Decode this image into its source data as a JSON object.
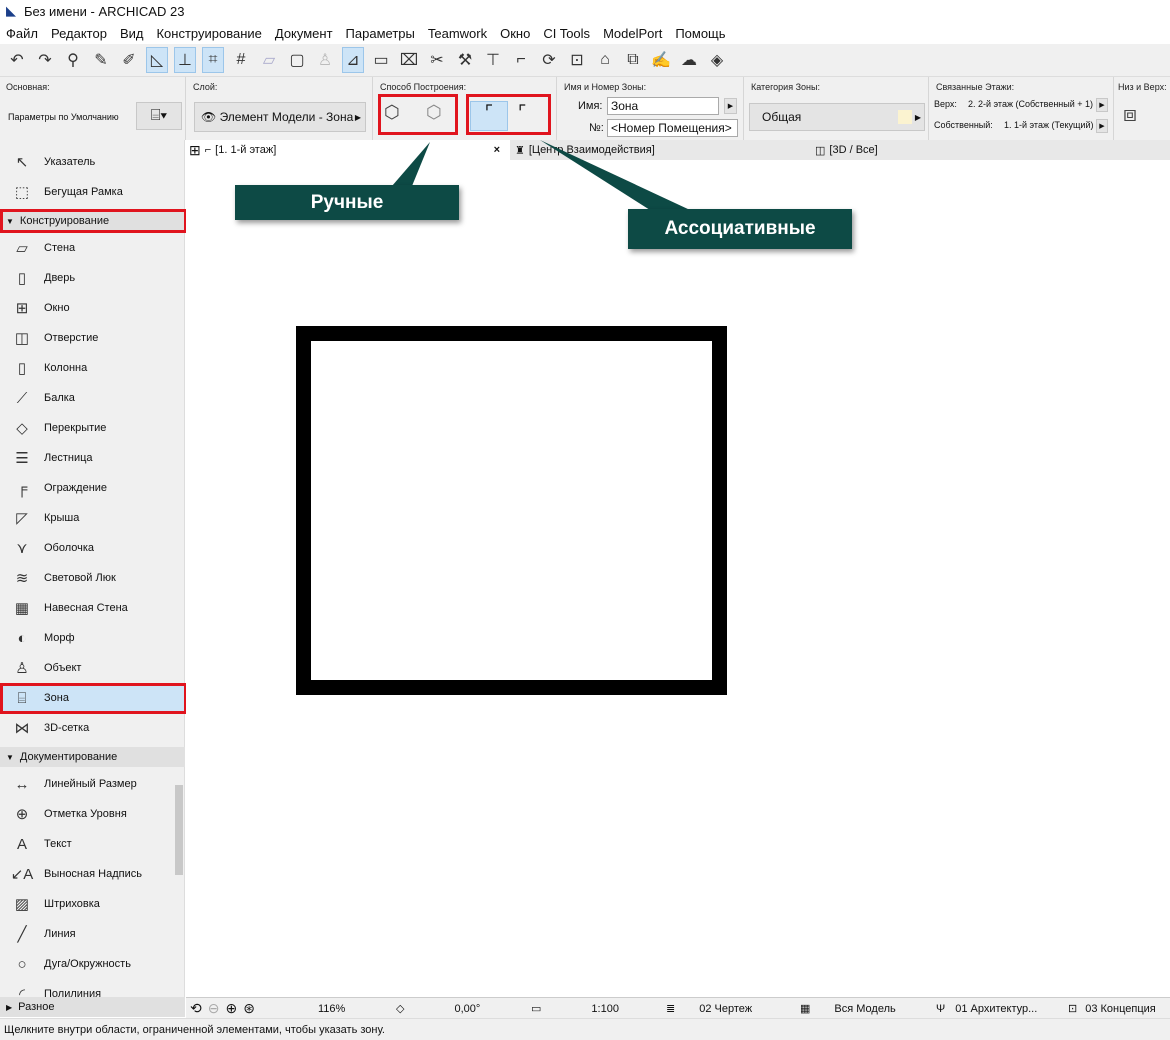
{
  "window": {
    "title": "Без имени - ARCHICAD 23"
  },
  "menu": [
    "Файл",
    "Редактор",
    "Вид",
    "Конструирование",
    "Документ",
    "Параметры",
    "Teamwork",
    "Окно",
    "CI Tools",
    "ModelPort",
    "Помощь"
  ],
  "infobox": {
    "main_label": "Основная:",
    "default_params": "Параметры по Умолчанию",
    "layer_label": "Слой:",
    "layer_value": "Элемент Модели - Зона",
    "method_label": "Способ Построения:",
    "zone_name_label": "Имя и Номер Зоны:",
    "name_label": "Имя:",
    "name_value": "Зона",
    "number_label": "№:",
    "number_value": "<Номер Помещения>",
    "category_label": "Категория Зоны:",
    "category_value": "Общая",
    "category_color": "#fbf3d0",
    "stories_label": "Связанные Этажи:",
    "top_label": "Верх:",
    "top_value": "2. 2-й этаж (Собственный + 1)",
    "own_label": "Собственный:",
    "own_value": "1. 1-й этаж (Текущий)",
    "bottom_top_label": "Низ и Верх:"
  },
  "tabs": [
    {
      "label": "[1. 1-й этаж]",
      "close": "×"
    },
    {
      "label": "[Центр Взаимодействия]"
    },
    {
      "label": "[3D / Все]"
    }
  ],
  "toolbox": {
    "items_top": [
      {
        "label": "Указатель",
        "icon": "↖"
      },
      {
        "label": "Бегущая Рамка",
        "icon": "⬚"
      }
    ],
    "section1": "Конструирование",
    "items1": [
      {
        "label": "Стена",
        "icon": "▱"
      },
      {
        "label": "Дверь",
        "icon": "▯"
      },
      {
        "label": "Окно",
        "icon": "⊞"
      },
      {
        "label": "Отверстие",
        "icon": "◫"
      },
      {
        "label": "Колонна",
        "icon": "▯"
      },
      {
        "label": "Балка",
        "icon": "⟋"
      },
      {
        "label": "Перекрытие",
        "icon": "◇"
      },
      {
        "label": "Лестница",
        "icon": "☰"
      },
      {
        "label": "Ограждение",
        "icon": "╒"
      },
      {
        "label": "Крыша",
        "icon": "◸"
      },
      {
        "label": "Оболочка",
        "icon": "⋎"
      },
      {
        "label": "Световой Люк",
        "icon": "≋"
      },
      {
        "label": "Навесная Стена",
        "icon": "▦"
      },
      {
        "label": "Морф",
        "icon": "◐"
      },
      {
        "label": "Объект",
        "icon": "♙"
      },
      {
        "label": "Зона",
        "icon": "⌸",
        "selected": true
      },
      {
        "label": "3D-сетка",
        "icon": "⋈"
      }
    ],
    "section2": "Документирование",
    "items2": [
      {
        "label": "Линейный Размер",
        "icon": "↔"
      },
      {
        "label": "Отметка Уровня",
        "icon": "⊕"
      },
      {
        "label": "Текст",
        "icon": "A"
      },
      {
        "label": "Выносная Надпись",
        "icon": "↙A"
      },
      {
        "label": "Штриховка",
        "icon": "▨"
      },
      {
        "label": "Линия",
        "icon": "╱"
      },
      {
        "label": "Дуга/Окружность",
        "icon": "○"
      },
      {
        "label": "Полилиния",
        "icon": "◜"
      }
    ],
    "section3": "Разное"
  },
  "callouts": {
    "manual": "Ручные",
    "associative": "Ассоциативные"
  },
  "statusbar": {
    "zoom": "116%",
    "angle": "0,00°",
    "scale": "1:100",
    "layer_combo": "02 Чертеж",
    "model_view": "Вся Модель",
    "pen_set": "01 Архитектур...",
    "renovation": "03 Концепция"
  },
  "hint": "Щелкните внутри области, ограниченной элементами, чтобы указать зону."
}
